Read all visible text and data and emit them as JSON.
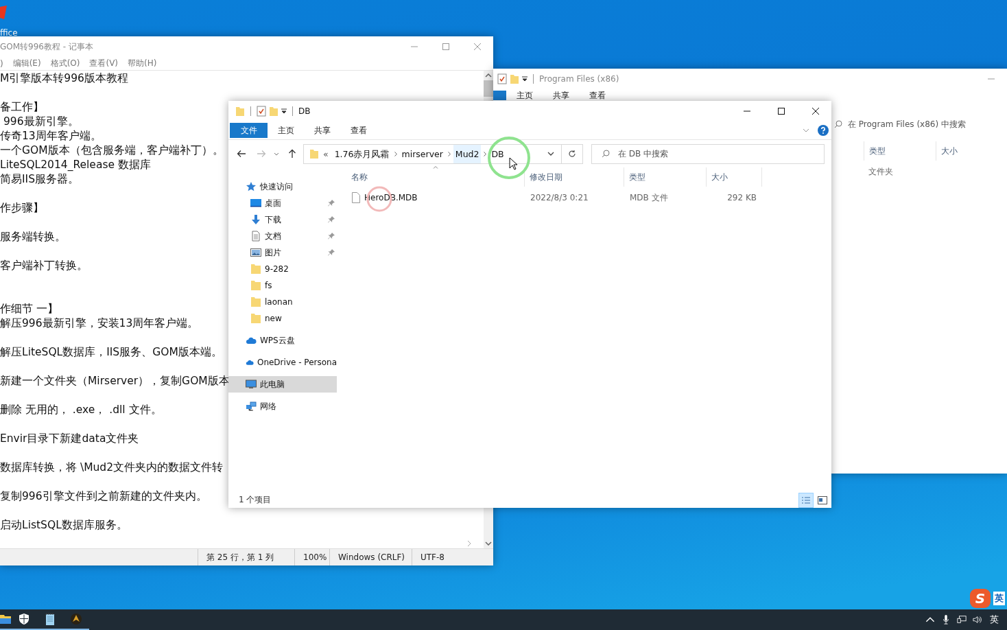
{
  "desktop_icon": {
    "label": "ffice"
  },
  "notepad": {
    "title": "GOM转996教程 - 记事本",
    "menu": [
      ")",
      "编辑(E)",
      "格式(O)",
      "查看(V)",
      "帮助(H)"
    ],
    "lines": [
      {
        "kind": "text",
        "text": "M引擎版本转996版本教程"
      },
      {
        "kind": "blank"
      },
      {
        "kind": "text",
        "text": "备工作】"
      },
      {
        "kind": "text",
        "text": " 996最新引擎。"
      },
      {
        "kind": "text",
        "text": "传奇13周年客户端。"
      },
      {
        "kind": "text",
        "text": "一个GOM版本（包含服务端，客户端补丁）。"
      },
      {
        "kind": "text",
        "text": "LiteSQL2014_Release 数据库"
      },
      {
        "kind": "text",
        "text": "简易IIS服务器。"
      },
      {
        "kind": "blank"
      },
      {
        "kind": "text",
        "text": "作步骤】"
      },
      {
        "kind": "blank"
      },
      {
        "kind": "text",
        "text": "服务端转换。"
      },
      {
        "kind": "blank"
      },
      {
        "kind": "text",
        "text": "客户端补丁转换。"
      },
      {
        "kind": "blank"
      },
      {
        "kind": "blank"
      },
      {
        "kind": "text",
        "text": "作细节 一】"
      },
      {
        "kind": "text",
        "text": "解压996最新引擎，安装13周年客户端。"
      },
      {
        "kind": "blank"
      },
      {
        "kind": "text",
        "text": "解压LiteSQL数据库，IIS服务、GOM版本端。"
      },
      {
        "kind": "blank"
      },
      {
        "kind": "text",
        "text": "新建一个文件夹（Mirserver），复制GOM版本"
      },
      {
        "kind": "blank"
      },
      {
        "kind": "text",
        "text": "删除 无用的， .exe， .dll 文件。"
      },
      {
        "kind": "blank"
      },
      {
        "kind": "text",
        "text": "Envir目录下新建data文件夹"
      },
      {
        "kind": "blank"
      },
      {
        "kind": "text",
        "text": "数据库转换，将 \\Mud2文件夹内的数据文件转"
      },
      {
        "kind": "blank"
      },
      {
        "kind": "text",
        "text": "复制996引擎文件到之前新建的文件夹内。"
      },
      {
        "kind": "blank"
      },
      {
        "kind": "text",
        "text": "启动ListSQL数据库服务。"
      }
    ],
    "status": [
      "第 25 行，第 1 列",
      "100%",
      "Windows (CRLF)",
      "UTF-8"
    ]
  },
  "back_explorer": {
    "title": "Program Files (x86)",
    "ribbon_tabs": [
      {
        "label": "主页",
        "selected": false
      },
      {
        "label": "共享",
        "selected": false
      },
      {
        "label": "查看",
        "selected": false
      }
    ],
    "search": {
      "placeholder": "在 Program Files (x86) 中搜索"
    },
    "columns": [
      "类型",
      "大小"
    ],
    "rows": [
      {
        "type": "文件夹"
      }
    ]
  },
  "explorer": {
    "title": "DB",
    "ribbon_tabs": [
      {
        "label": "文件",
        "selected": true
      },
      {
        "label": "主页",
        "selected": false
      },
      {
        "label": "共享",
        "selected": false
      },
      {
        "label": "查看",
        "selected": false
      }
    ],
    "overflow": "«",
    "breadcrumb": [
      "1.76赤月风霜",
      "mirserver",
      "Mud2",
      "DB"
    ],
    "search": {
      "placeholder": "在 DB 中搜索"
    },
    "sidebar": [
      {
        "kind": "header",
        "label": "快速访问",
        "pinned": false,
        "selected": false
      },
      {
        "kind": "item",
        "label": "桌面",
        "pinned": true,
        "selected": false
      },
      {
        "kind": "item",
        "label": "下载",
        "pinned": true,
        "selected": false
      },
      {
        "kind": "item",
        "label": "文档",
        "pinned": true,
        "selected": false
      },
      {
        "kind": "item",
        "label": "图片",
        "pinned": true,
        "selected": false
      },
      {
        "kind": "item",
        "label": "9-282",
        "pinned": false,
        "selected": false
      },
      {
        "kind": "item",
        "label": "fs",
        "pinned": false,
        "selected": false
      },
      {
        "kind": "item",
        "label": "laonan",
        "pinned": false,
        "selected": false
      },
      {
        "kind": "item",
        "label": "new",
        "pinned": false,
        "selected": false
      },
      {
        "kind": "header",
        "label": "WPS云盘",
        "pinned": false,
        "selected": false
      },
      {
        "kind": "header",
        "label": "OneDrive - Persona",
        "pinned": false,
        "selected": false
      },
      {
        "kind": "header",
        "label": "此电脑",
        "pinned": false,
        "selected": true
      },
      {
        "kind": "header",
        "label": "网络",
        "pinned": false,
        "selected": false
      }
    ],
    "columns": [
      "名称",
      "修改日期",
      "类型",
      "大小"
    ],
    "files": [
      {
        "name": "HeroDB.MDB",
        "modified": "2022/8/3 0:21",
        "type": "MDB 文件",
        "size": "292 KB"
      }
    ],
    "status": "1 个项目",
    "views": [
      {
        "kind": "details",
        "selected": true
      },
      {
        "kind": "tiles",
        "selected": false
      }
    ]
  },
  "ime": {
    "logo": "S",
    "language": "英"
  },
  "taskbar": {
    "apps": [
      {
        "kind": "explorer",
        "open": true
      },
      {
        "kind": "shield",
        "open": true
      },
      {
        "kind": "notepad",
        "open": true
      },
      {
        "kind": "game",
        "open": true
      }
    ],
    "language": "英"
  }
}
